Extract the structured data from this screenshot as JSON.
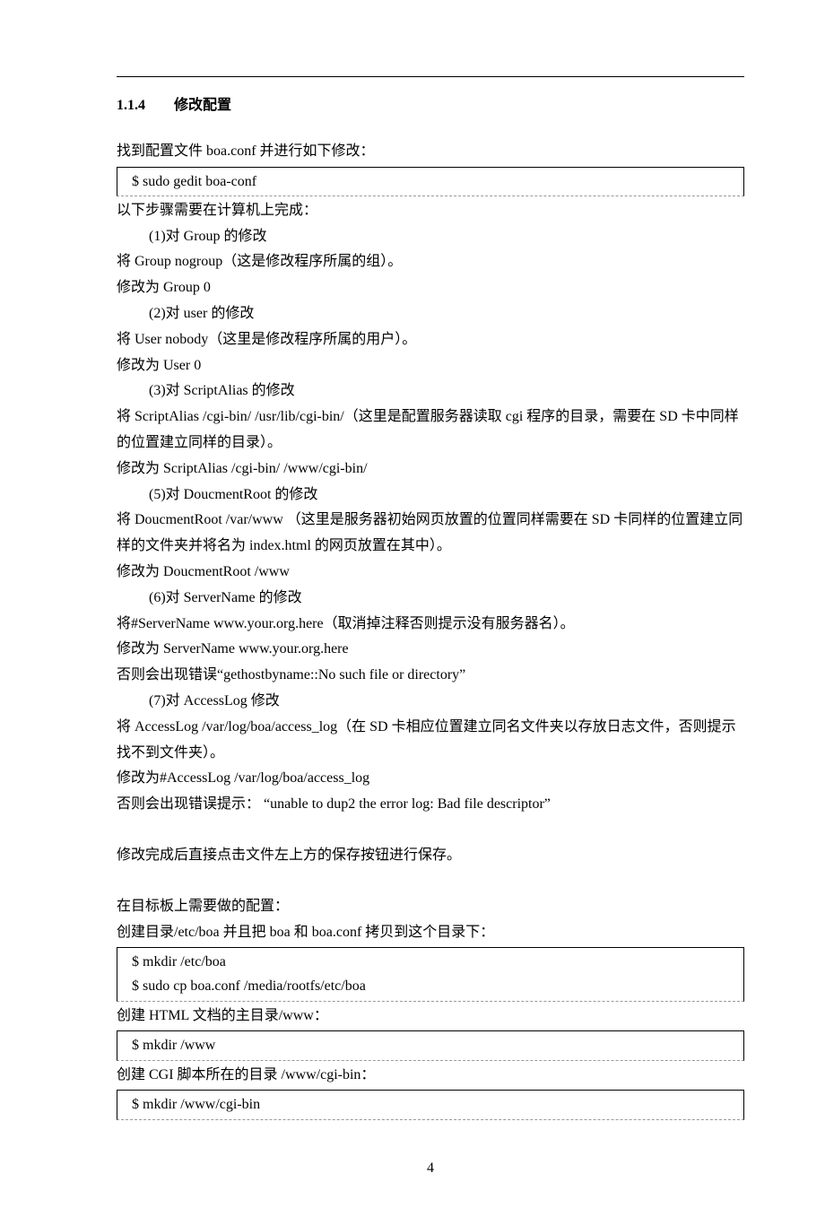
{
  "heading": {
    "number": "1.1.4",
    "title": "修改配置"
  },
  "p1": "找到配置文件 boa.conf 并进行如下修改：",
  "code1": "$ sudo gedit boa-conf",
  "p2": "以下步骤需要在计算机上完成：",
  "s1": "(1)对 Group 的修改",
  "p3": "将 Group nogroup（这是修改程序所属的组）。",
  "p4": "修改为  Group 0",
  "s2": "(2)对 user 的修改",
  "p5": "将 User nobody（这里是修改程序所属的用户）。",
  "p6": "修改为  User 0",
  "s3": "(3)对 ScriptAlias 的修改",
  "p7": "将 ScriptAlias /cgi-bin/ /usr/lib/cgi-bin/（这里是配置服务器读取 cgi 程序的目录，需要在 SD 卡中同样的位置建立同样的目录）。",
  "p8": "修改为  ScriptAlias /cgi-bin/ /www/cgi-bin/",
  "s5": "(5)对 DoucmentRoot 的修改",
  "p9": "将 DoucmentRoot /var/www  （这里是服务器初始网页放置的位置同样需要在 SD 卡同样的位置建立同样的文件夹并将名为 index.html 的网页放置在其中）。",
  "p10": "修改为 DoucmentRoot /www",
  "s6": "(6)对 ServerName 的修改",
  "p11": "将#ServerName www.your.org.here（取消掉注释否则提示没有服务器名）。",
  "p12": "修改为  ServerName www.your.org.here",
  "p13": "否则会出现错误“gethostbyname::No such file or directory”",
  "s7": "(7)对 AccessLog 修改",
  "p14": "将 AccessLog /var/log/boa/access_log（在 SD 卡相应位置建立同名文件夹以存放日志文件，否则提示找不到文件夹）。",
  "p15": "修改为#AccessLog /var/log/boa/access_log",
  "p16": "否则会出现错误提示： “unable to dup2 the error log: Bad file descriptor”",
  "p17": "修改完成后直接点击文件左上方的保存按钮进行保存。",
  "p18": "在目标板上需要做的配置：",
  "p19": "创建目录/etc/boa 并且把 boa  和  boa.conf 拷贝到这个目录下：",
  "code2a": "$ mkdir /etc/boa",
  "code2b": "$ sudo cp boa.conf /media/rootfs/etc/boa",
  "p20": "创建 HTML 文档的主目录/www：",
  "code3": "$ mkdir /www",
  "p21": "创建 CGI 脚本所在的目录  /www/cgi-bin：",
  "code4": "$ mkdir /www/cgi-bin",
  "pagenum": "4"
}
